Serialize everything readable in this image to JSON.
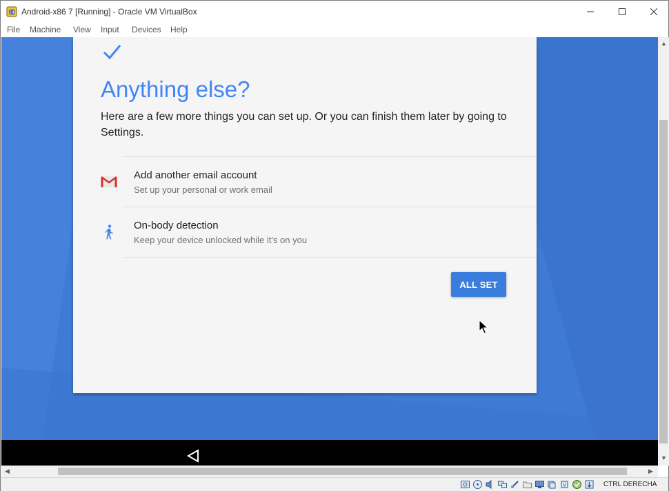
{
  "window": {
    "title": "Android-x86 7 [Running] - Oracle VM VirtualBox",
    "icon": "virtualbox-icon"
  },
  "menu": {
    "items": [
      {
        "label": "File"
      },
      {
        "label": "Machine"
      },
      {
        "label": "View"
      },
      {
        "label": "Input"
      },
      {
        "label": "Devices"
      },
      {
        "label": "Help"
      }
    ]
  },
  "setup": {
    "heading": "Anything else?",
    "description": "Here are a few more things you can set up. Or you can finish them later by going to Settings.",
    "options": [
      {
        "title": "Add another email account",
        "subtitle": "Set up your personal or work email",
        "icon": "gmail-icon"
      },
      {
        "title": "On-body detection",
        "subtitle": "Keep your device unlocked while it's on you",
        "icon": "walking-person-icon"
      }
    ],
    "primary_button": "ALL SET"
  },
  "statusbar": {
    "host_key": "CTRL DERECHA"
  },
  "colors": {
    "accent": "#4285f4",
    "button": "#3b7ddd",
    "vm_background": "#3f7ad4",
    "gmail_red": "#d93025"
  }
}
